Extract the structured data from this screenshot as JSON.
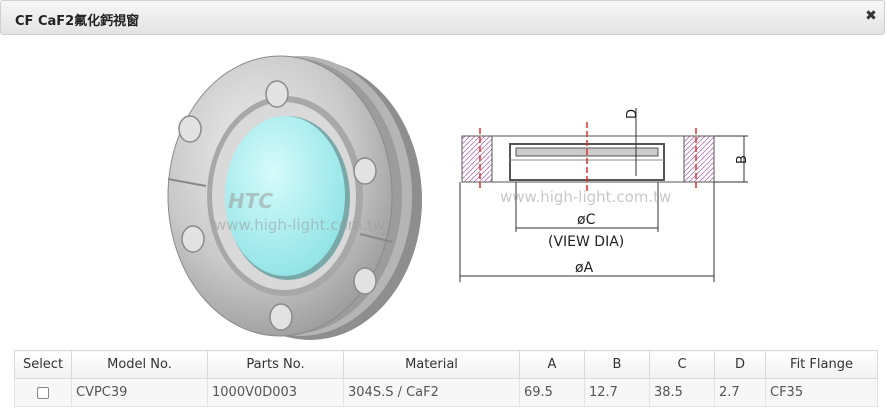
{
  "window": {
    "title": "CF CaF2氟化鈣視窗",
    "close_glyph": "✖"
  },
  "watermark": {
    "text": "www.high-light.com.tw",
    "logo": "HTC"
  },
  "drawing": {
    "label_d": "D",
    "label_b": "B",
    "label_c": "øC",
    "label_view": "(VIEW  DIA)",
    "label_a": "øA"
  },
  "table": {
    "headers": [
      "Select",
      "Model No.",
      "Parts No.",
      "Material",
      "A",
      "B",
      "C",
      "D",
      "Fit Flange"
    ],
    "rows": [
      {
        "model": "CVPC39",
        "part": "1000V0D003",
        "material": "304S.S / CaF2",
        "a": "69.5",
        "b": "12.7",
        "c": "38.5",
        "d": "2.7",
        "flange": "CF35"
      }
    ]
  }
}
